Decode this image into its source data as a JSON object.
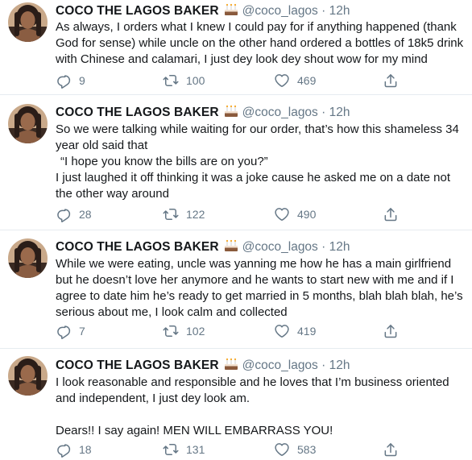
{
  "colors": {
    "text": "#14171a",
    "secondary": "#657786",
    "divider": "#e6ecf0"
  },
  "tweets": [
    {
      "name": "COCO THE LAGOS BAKER",
      "handle": "@coco_lagos",
      "dot": "·",
      "time": "12h",
      "badge_icon": "cake-icon",
      "lines": [
        "As always, I orders what I knew I could pay for if anything happened (thank God for sense) while uncle on the other hand ordered a bottles of 18k5 drink with Chinese and calamari, I just dey look dey shout wow for my mind"
      ],
      "replies": "9",
      "retweets": "100",
      "likes": "469"
    },
    {
      "name": "COCO THE LAGOS BAKER",
      "handle": "@coco_lagos",
      "dot": "·",
      "time": "12h",
      "badge_icon": "cake-icon",
      "line1": "So we were talking while waiting for our order, that’s how this shameless 34 year old said that",
      "line2": "“I hope you know the bills are on you?”",
      "line3": "I just laughed it off thinking it was a joke cause he asked me on a date not the other way around",
      "replies": "28",
      "retweets": "122",
      "likes": "490"
    },
    {
      "name": "COCO THE LAGOS BAKER",
      "handle": "@coco_lagos",
      "dot": "·",
      "time": "12h",
      "badge_icon": "cake-icon",
      "text": "While we were eating, uncle was yanning me how he has a main girlfriend but he doesn’t love her anymore and he wants to start new with me and if I agree to date him he’s ready to get married in 5 months, blah blah blah, he’s serious about me, I look calm and collected",
      "replies": "7",
      "retweets": "102",
      "likes": "419"
    },
    {
      "name": "COCO THE LAGOS BAKER",
      "handle": "@coco_lagos",
      "dot": "·",
      "time": "12h",
      "badge_icon": "cake-icon",
      "line1": "I look reasonable and responsible and he loves that I’m business oriented and independent, I just dey look am.",
      "line2": "Dears!! I say again! MEN WILL EMBARRASS YOU!",
      "replies": "18",
      "retweets": "131",
      "likes": "583"
    }
  ],
  "icons": {
    "reply": "reply-icon",
    "retweet": "retweet-icon",
    "like": "heart-icon",
    "share": "share-icon"
  }
}
